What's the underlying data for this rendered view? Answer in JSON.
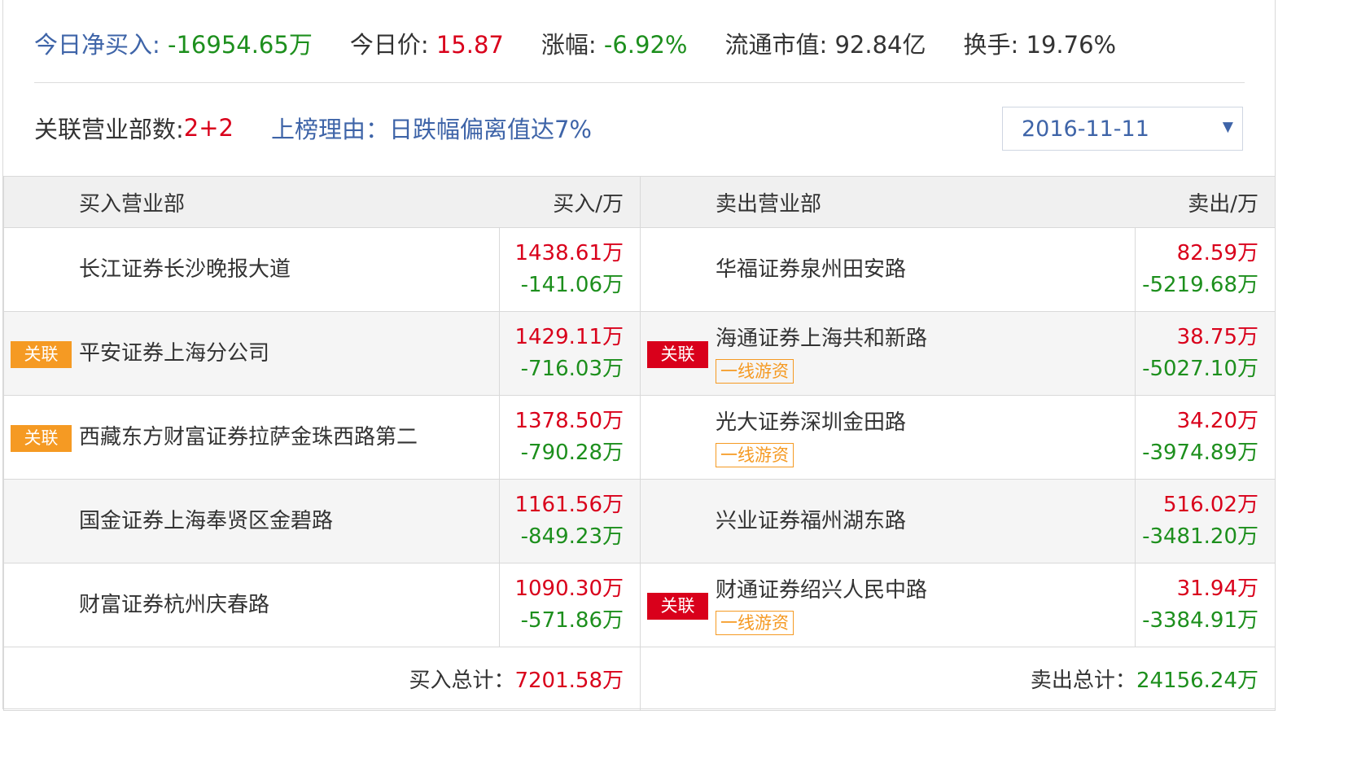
{
  "header": {
    "net_buy": {
      "label": "今日净买入: ",
      "value": "-16954.65万"
    },
    "price": {
      "label": "今日价: ",
      "value": "15.87"
    },
    "change": {
      "label": "涨幅: ",
      "value": "-6.92%"
    },
    "market_cap": {
      "label": "流通市值: ",
      "value": "92.84亿"
    },
    "turnover": {
      "label": "换手: ",
      "value": "19.76%"
    }
  },
  "meta": {
    "branches_label": "关联营业部数: ",
    "branches_value": "2+2",
    "reason": "上榜理由：日跌幅偏离值达7%",
    "date_selected": "2016-11-11",
    "caret": "▼"
  },
  "table": {
    "buy_header": "买入营业部",
    "buy_amount_header": "买入/万",
    "sell_header": "卖出营业部",
    "sell_amount_header": "卖出/万",
    "rows": [
      {
        "buy_name": "长江证券长沙晚报大道",
        "buy_badge": "",
        "buy_in": "1438.61万",
        "buy_out": "-141.06万",
        "sell_name": "华福证券泉州田安路",
        "sell_badge": "",
        "sell_tag": "",
        "sell_in": "82.59万",
        "sell_out": "-5219.68万"
      },
      {
        "buy_name": "平安证券上海分公司",
        "buy_badge": "关联",
        "buy_in": "1429.11万",
        "buy_out": "-716.03万",
        "sell_name": "海通证券上海共和新路",
        "sell_badge": "关联",
        "sell_tag": "一线游资",
        "sell_in": "38.75万",
        "sell_out": "-5027.10万"
      },
      {
        "buy_name": "西藏东方财富证券拉萨金珠西路第二",
        "buy_badge": "关联",
        "buy_in": "1378.50万",
        "buy_out": "-790.28万",
        "sell_name": "光大证券深圳金田路",
        "sell_badge": "",
        "sell_tag": "一线游资",
        "sell_in": "34.20万",
        "sell_out": "-3974.89万"
      },
      {
        "buy_name": "国金证券上海奉贤区金碧路",
        "buy_badge": "",
        "buy_in": "1161.56万",
        "buy_out": "-849.23万",
        "sell_name": "兴业证券福州湖东路",
        "sell_badge": "",
        "sell_tag": "",
        "sell_in": "516.02万",
        "sell_out": "-3481.20万"
      },
      {
        "buy_name": "财富证券杭州庆春路",
        "buy_badge": "",
        "buy_in": "1090.30万",
        "buy_out": "-571.86万",
        "sell_name": "财通证券绍兴人民中路",
        "sell_badge": "关联",
        "sell_tag": "一线游资",
        "sell_in": "31.94万",
        "sell_out": "-3384.91万"
      }
    ],
    "buy_total_label": "买入总计：",
    "buy_total_value": "7201.58万",
    "sell_total_label": "卖出总计：",
    "sell_total_value": "24156.24万"
  },
  "colors": {
    "positive": "#d9001b",
    "negative": "#1d8f1d",
    "link_blue": "#3e64a8",
    "badge_orange": "#f59a23",
    "badge_red": "#d9001b"
  }
}
